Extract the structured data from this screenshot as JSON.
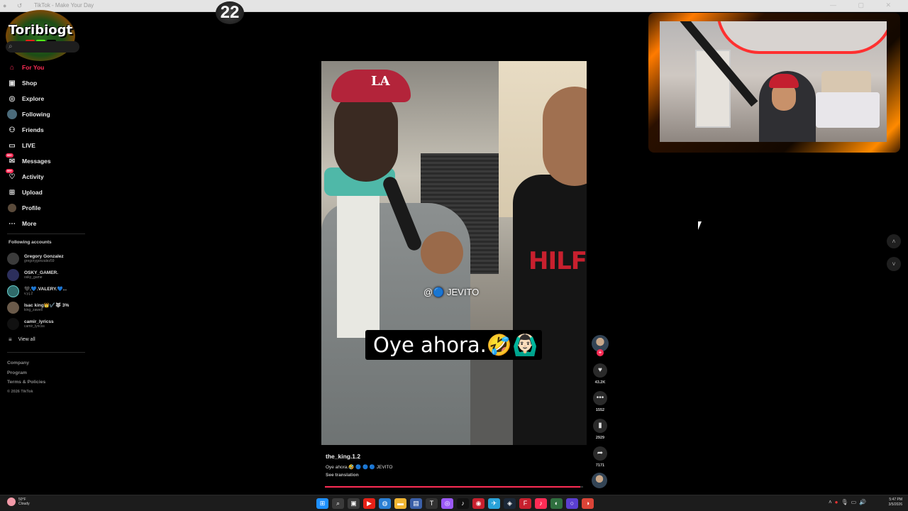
{
  "browser": {
    "tab_title": "TikTok - Make Your Day",
    "nav_glyphs": "● ↺",
    "window_controls": "— ▢ ✕"
  },
  "overlay": {
    "counter": "22",
    "logo_text": "Toribiogt",
    "logo_badges": [
      "▶",
      "K",
      "♪"
    ]
  },
  "sidebar": {
    "search_icon": "search-icon",
    "items": [
      {
        "label": "For You",
        "icon": "home-icon",
        "active": true
      },
      {
        "label": "Shop",
        "icon": "shop-icon"
      },
      {
        "label": "Explore",
        "icon": "compass-icon"
      },
      {
        "label": "Following",
        "icon": "following-icon"
      },
      {
        "label": "Friends",
        "icon": "friends-icon"
      },
      {
        "label": "LIVE",
        "icon": "live-icon"
      },
      {
        "label": "Messages",
        "icon": "messages-icon",
        "badge": "99+"
      },
      {
        "label": "Activity",
        "icon": "activity-icon",
        "badge": "99+"
      },
      {
        "label": "Upload",
        "icon": "upload-icon"
      },
      {
        "label": "Profile",
        "icon": "profile-icon"
      },
      {
        "label": "More",
        "icon": "more-icon"
      }
    ],
    "following_title": "Following accounts",
    "accounts": [
      {
        "name": "Gregory Gonzalez",
        "handle": "gregorygonzalez59"
      },
      {
        "name": "OSKY_GAMER.",
        "handle": "osky_game"
      },
      {
        "name": "🖤.💙.VALERY.💙...",
        "handle": "v.y.j.2"
      },
      {
        "name": "Isac king👑✔️🐺 3%",
        "handle": "king_zawell"
      },
      {
        "name": "camir_lyricss",
        "handle": "camir_lyricss"
      }
    ],
    "view_all": "View all",
    "footer": [
      "Company",
      "Program",
      "Terms & Policies"
    ],
    "copyright": "© 2026 TikTok"
  },
  "video": {
    "caption": "Oye ahora.🤣🙆🏻‍♂️",
    "watermark": "@🔵 JEVITO",
    "cap_logo": "LA",
    "shirt_text": "HILFI",
    "author": "the_king.1.2",
    "description": "Oye ahora.🤣 🔵 🔵 🔵 JEVITO",
    "see_translation": "See translation",
    "progress": 0.99
  },
  "actions": {
    "likes": "43.2K",
    "comments": "1552",
    "saves": "2929",
    "shares": "7171"
  },
  "taskbar": {
    "temp": "50°F",
    "condition": "Cloudy",
    "time": "5:47 PM",
    "date": "3/5/2026",
    "icons": [
      {
        "glyph": "⊞",
        "name": "start",
        "color": "#1e90ff"
      },
      {
        "glyph": "⌕",
        "name": "search",
        "color": "#3a3a3a"
      },
      {
        "glyph": "▣",
        "name": "task-view",
        "color": "#3a3a3a"
      },
      {
        "glyph": "▶",
        "name": "youtube",
        "color": "#e62117"
      },
      {
        "glyph": "◍",
        "name": "edge",
        "color": "#2a7fd4"
      },
      {
        "glyph": "▬",
        "name": "explorer",
        "color": "#f2b632"
      },
      {
        "glyph": "▤",
        "name": "store",
        "color": "#3a5fa8"
      },
      {
        "glyph": "T",
        "name": "tiktok-studio",
        "color": "#333"
      },
      {
        "glyph": "◎",
        "name": "messenger",
        "color": "#9b59f6"
      },
      {
        "glyph": "♪",
        "name": "tiktok",
        "color": "#111"
      },
      {
        "glyph": "◉",
        "name": "app-red",
        "color": "#c8202e"
      },
      {
        "glyph": "✈",
        "name": "telegram",
        "color": "#2aa3d9"
      },
      {
        "glyph": "◈",
        "name": "steam",
        "color": "#1b2838"
      },
      {
        "glyph": "F",
        "name": "app-f",
        "color": "#c8202e"
      },
      {
        "glyph": "♪",
        "name": "tiktok-live",
        "color": "#fe2c55"
      },
      {
        "glyph": "◐",
        "name": "chrome-active",
        "color": "#2f6f3f"
      },
      {
        "glyph": "○",
        "name": "obs",
        "color": "#5b3fd1"
      },
      {
        "glyph": "◑",
        "name": "chrome",
        "color": "#db4437"
      }
    ],
    "tray": [
      "˄",
      "●",
      "🎙",
      "▭",
      "🔊"
    ]
  },
  "colors": {
    "accent": "#fe2c55"
  }
}
